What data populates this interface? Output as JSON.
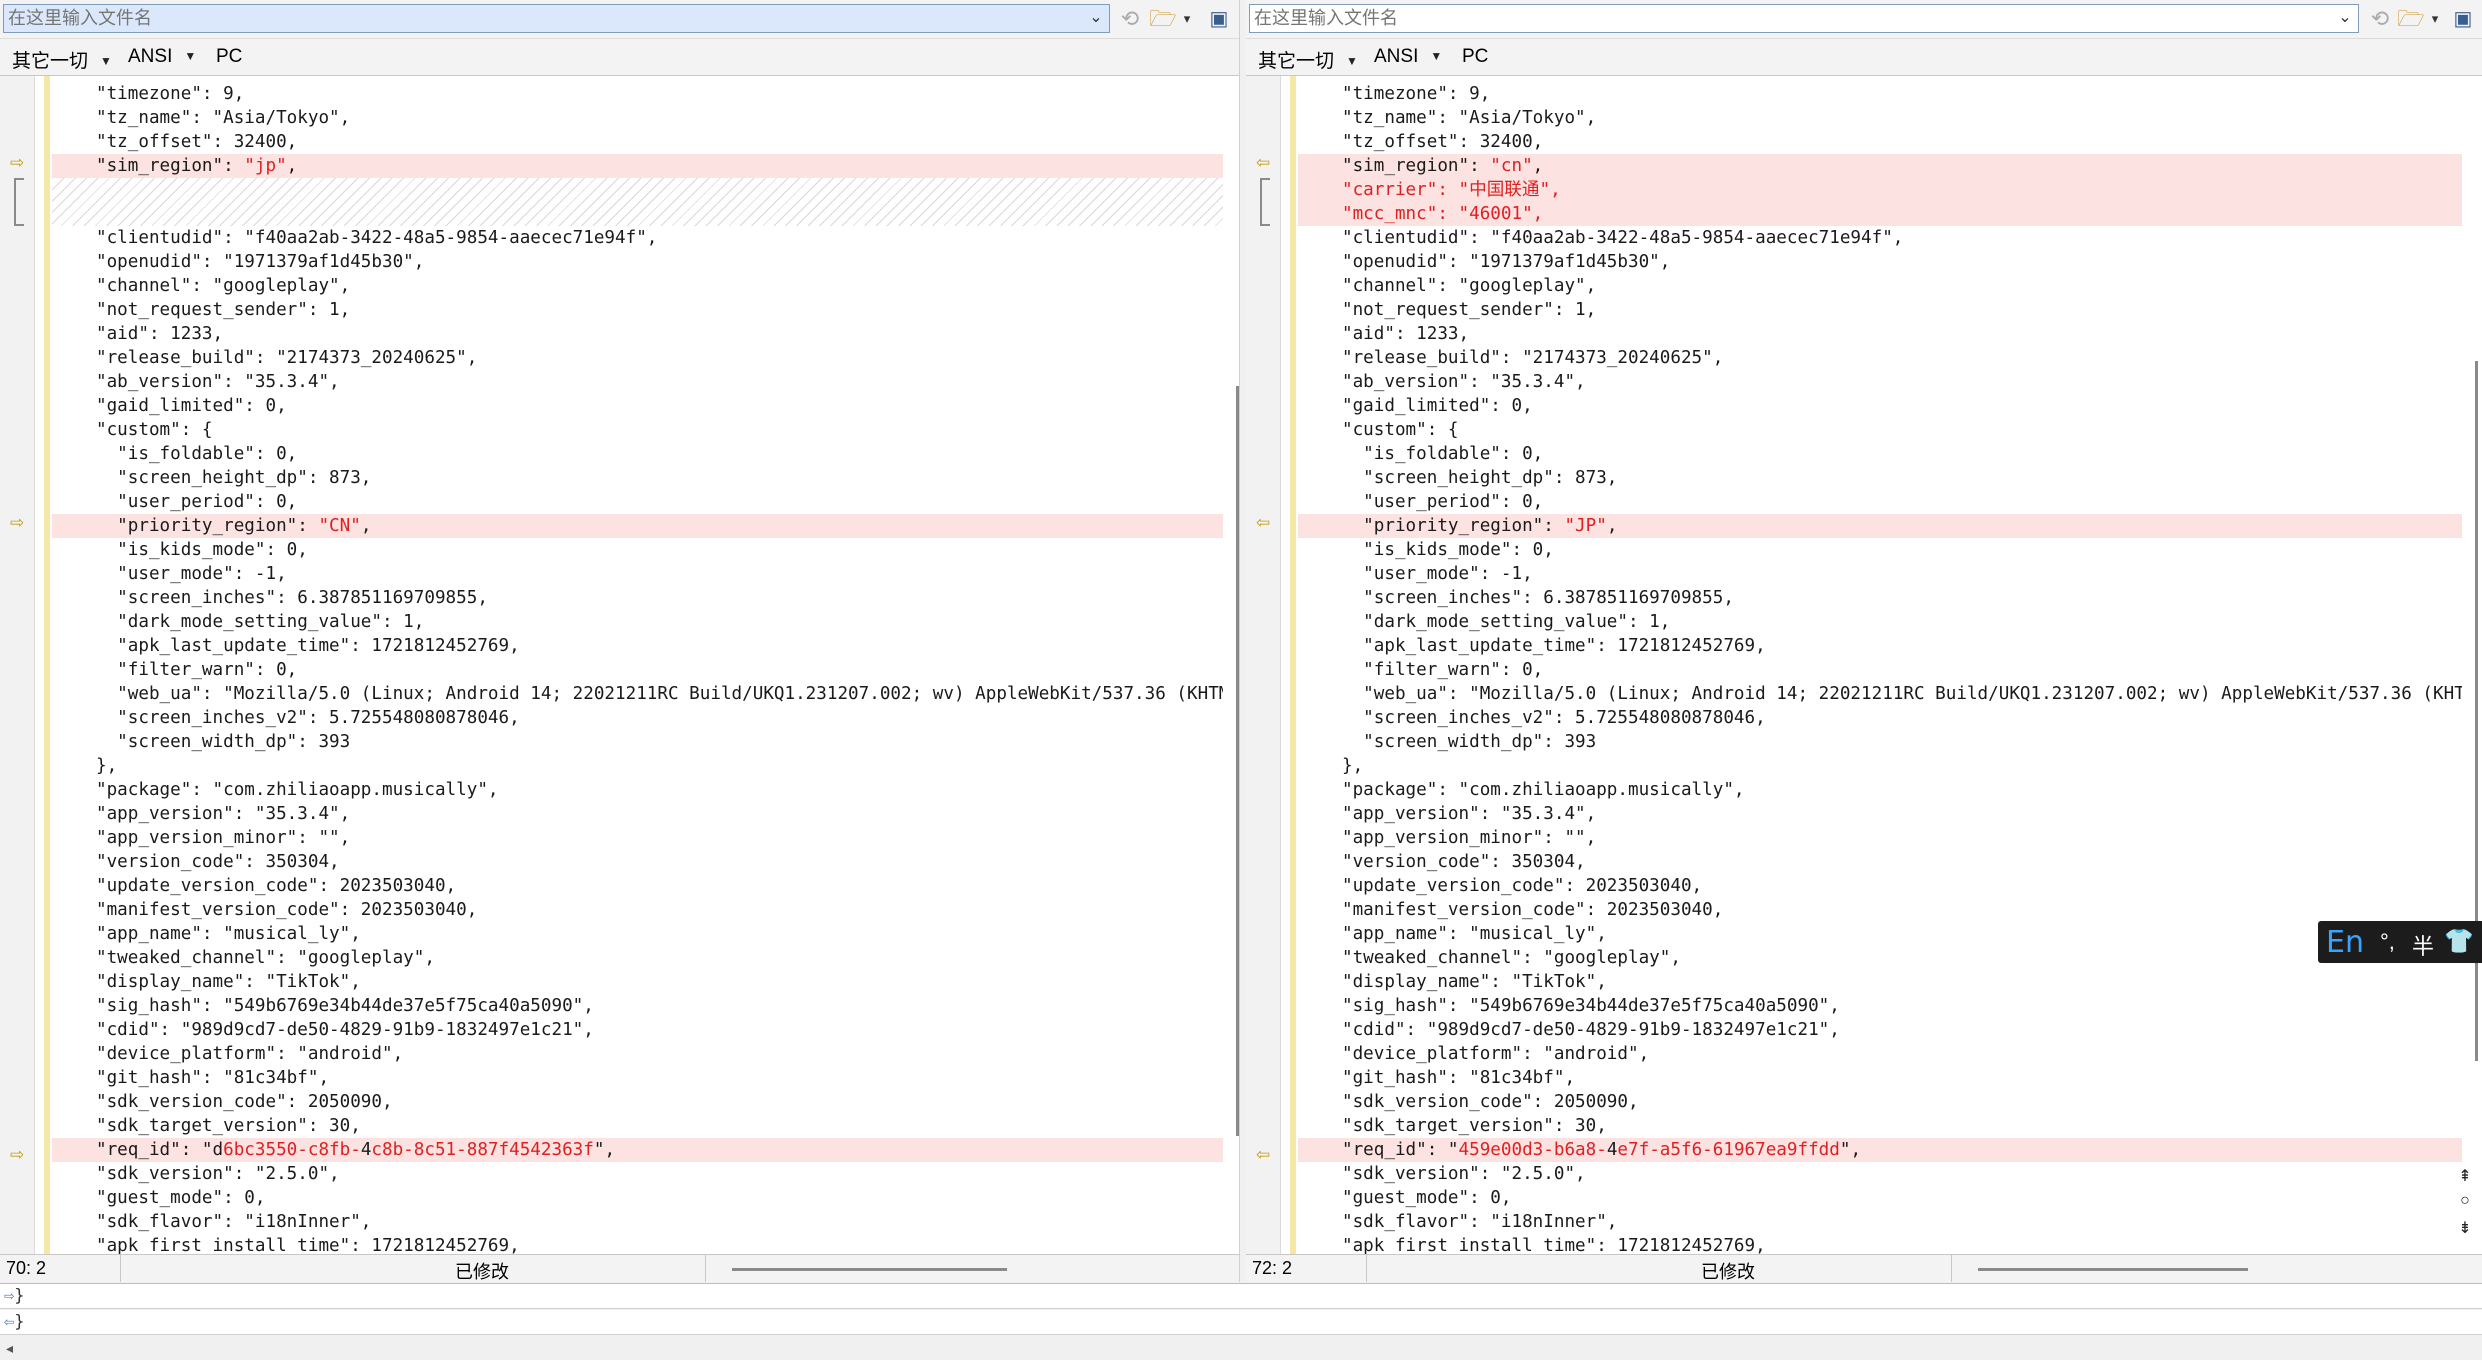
{
  "left": {
    "path_placeholder": "在这里输入文件名",
    "options": {
      "filter": "其它一切",
      "encoding": "ANSI",
      "line_ending": "PC"
    },
    "status": {
      "position": "70: 2",
      "modified": "已修改"
    },
    "lines": [
      {
        "text": "\"timezone\": 9,"
      },
      {
        "text": "\"tz_name\": \"Asia/Tokyo\","
      },
      {
        "text": "\"tz_offset\": 32400,"
      },
      {
        "text": "\"sim_region\": ",
        "hl": "\"jp\"",
        "tail": ",",
        "diff": true
      },
      {
        "placeholder": true
      },
      {
        "text": "\"clientudid\": \"f40aa2ab-3422-48a5-9854-aaecec71e94f\","
      },
      {
        "text": "\"openudid\": \"1971379af1d45b30\","
      },
      {
        "text": "\"channel\": \"googleplay\","
      },
      {
        "text": "\"not_request_sender\": 1,"
      },
      {
        "text": "\"aid\": 1233,"
      },
      {
        "text": "\"release_build\": \"2174373_20240625\","
      },
      {
        "text": "\"ab_version\": \"35.3.4\","
      },
      {
        "text": "\"gaid_limited\": 0,"
      },
      {
        "text": "\"custom\": {"
      },
      {
        "text": "  \"is_foldable\": 0,"
      },
      {
        "text": "  \"screen_height_dp\": 873,"
      },
      {
        "text": "  \"user_period\": 0,"
      },
      {
        "text": "  \"priority_region\": ",
        "hl": "\"CN\"",
        "tail": ",",
        "diff": true
      },
      {
        "text": "  \"is_kids_mode\": 0,"
      },
      {
        "text": "  \"user_mode\": -1,"
      },
      {
        "text": "  \"screen_inches\": 6.387851169709855,"
      },
      {
        "text": "  \"dark_mode_setting_value\": 1,"
      },
      {
        "text": "  \"apk_last_update_time\": 1721812452769,"
      },
      {
        "text": "  \"filter_warn\": 0,"
      },
      {
        "text": "  \"web_ua\": \"Mozilla/5.0 (Linux; Android 14; 22021211RC Build/UKQ1.231207.002; wv) AppleWebKit/537.36 (KHTM"
      },
      {
        "text": "  \"screen_inches_v2\": 5.725548080878046,"
      },
      {
        "text": "  \"screen_width_dp\": 393"
      },
      {
        "text": "},"
      },
      {
        "text": "\"package\": \"com.zhiliaoapp.musically\","
      },
      {
        "text": "\"app_version\": \"35.3.4\","
      },
      {
        "text": "\"app_version_minor\": \"\","
      },
      {
        "text": "\"version_code\": 350304,"
      },
      {
        "text": "\"update_version_code\": 2023503040,"
      },
      {
        "text": "\"manifest_version_code\": 2023503040,"
      },
      {
        "text": "\"app_name\": \"musical_ly\","
      },
      {
        "text": "\"tweaked_channel\": \"googleplay\","
      },
      {
        "text": "\"display_name\": \"TikTok\","
      },
      {
        "text": "\"sig_hash\": \"549b6769e34b44de37e5f75ca40a5090\","
      },
      {
        "text": "\"cdid\": \"989d9cd7-de50-4829-91b9-1832497e1c21\","
      },
      {
        "text": "\"device_platform\": \"android\","
      },
      {
        "text": "\"git_hash\": \"81c34bf\","
      },
      {
        "text": "\"sdk_version_code\": 2050090,"
      },
      {
        "text": "\"sdk_target_version\": 30,"
      },
      {
        "text": "\"req_id\": \"d",
        "hl": "6bc3550-c8fb-",
        "mid": "4",
        "hl2": "c8b-8c51-887f4542363f",
        "tail": "\",",
        "diff": true
      },
      {
        "text": "\"sdk_version\": \"2.5.0\","
      },
      {
        "text": "\"guest_mode\": 0,"
      },
      {
        "text": "\"sdk_flavor\": \"i18nInner\","
      },
      {
        "text": "\"apk_first_install_time\": 1721812452769,"
      }
    ]
  },
  "right": {
    "path_placeholder": "在这里输入文件名",
    "options": {
      "filter": "其它一切",
      "encoding": "ANSI",
      "line_ending": "PC"
    },
    "status": {
      "position": "72: 2",
      "modified": "已修改"
    },
    "lines": [
      {
        "text": "\"timezone\": 9,"
      },
      {
        "text": "\"tz_name\": \"Asia/Tokyo\","
      },
      {
        "text": "\"tz_offset\": 32400,"
      },
      {
        "text": "\"sim_region\": ",
        "hl": "\"cn\"",
        "tail": ",",
        "diff": true
      },
      {
        "text": "\"carrier\": \"中国联通\",",
        "added": true
      },
      {
        "text": "\"mcc_mnc\": \"46001\",",
        "added": true
      },
      {
        "text": "\"clientudid\": \"f40aa2ab-3422-48a5-9854-aaecec71e94f\","
      },
      {
        "text": "\"openudid\": \"1971379af1d45b30\","
      },
      {
        "text": "\"channel\": \"googleplay\","
      },
      {
        "text": "\"not_request_sender\": 1,"
      },
      {
        "text": "\"aid\": 1233,"
      },
      {
        "text": "\"release_build\": \"2174373_20240625\","
      },
      {
        "text": "\"ab_version\": \"35.3.4\","
      },
      {
        "text": "\"gaid_limited\": 0,"
      },
      {
        "text": "\"custom\": {"
      },
      {
        "text": "  \"is_foldable\": 0,"
      },
      {
        "text": "  \"screen_height_dp\": 873,"
      },
      {
        "text": "  \"user_period\": 0,"
      },
      {
        "text": "  \"priority_region\": ",
        "hl": "\"JP\"",
        "tail": ",",
        "diff": true
      },
      {
        "text": "  \"is_kids_mode\": 0,"
      },
      {
        "text": "  \"user_mode\": -1,"
      },
      {
        "text": "  \"screen_inches\": 6.387851169709855,"
      },
      {
        "text": "  \"dark_mode_setting_value\": 1,"
      },
      {
        "text": "  \"apk_last_update_time\": 1721812452769,"
      },
      {
        "text": "  \"filter_warn\": 0,"
      },
      {
        "text": "  \"web_ua\": \"Mozilla/5.0 (Linux; Android 14; 22021211RC Build/UKQ1.231207.002; wv) AppleWebKit/537.36 (KHT"
      },
      {
        "text": "  \"screen_inches_v2\": 5.725548080878046,"
      },
      {
        "text": "  \"screen_width_dp\": 393"
      },
      {
        "text": "},"
      },
      {
        "text": "\"package\": \"com.zhiliaoapp.musically\","
      },
      {
        "text": "\"app_version\": \"35.3.4\","
      },
      {
        "text": "\"app_version_minor\": \"\","
      },
      {
        "text": "\"version_code\": 350304,"
      },
      {
        "text": "\"update_version_code\": 2023503040,"
      },
      {
        "text": "\"manifest_version_code\": 2023503040,"
      },
      {
        "text": "\"app_name\": \"musical_ly\","
      },
      {
        "text": "\"tweaked_channel\": \"googleplay\","
      },
      {
        "text": "\"display_name\": \"TikTok\","
      },
      {
        "text": "\"sig_hash\": \"549b6769e34b44de37e5f75ca40a5090\","
      },
      {
        "text": "\"cdid\": \"989d9cd7-de50-4829-91b9-1832497e1c21\","
      },
      {
        "text": "\"device_platform\": \"android\","
      },
      {
        "text": "\"git_hash\": \"81c34bf\","
      },
      {
        "text": "\"sdk_version_code\": 2050090,"
      },
      {
        "text": "\"sdk_target_version\": 30,"
      },
      {
        "text": "\"req_id\": \"",
        "hl": "459e00d3-b6a8-",
        "mid": "4",
        "hl2": "e7f-a5f6-61967ea9ffdd",
        "tail": "\",",
        "diff": true
      },
      {
        "text": "\"sdk_version\": \"2.5.0\","
      },
      {
        "text": "\"guest_mode\": 0,"
      },
      {
        "text": "\"sdk_flavor\": \"i18nInner\","
      },
      {
        "text": "\"apk_first_install_time\": 1721812452769,"
      }
    ]
  },
  "bottom": {
    "line1": "}",
    "line2": "}"
  },
  "ime": {
    "lang": "En",
    "punct": "°,",
    "width": "半"
  },
  "colors": {
    "diff_bg": "#fde2e2",
    "diff_text": "#e02020",
    "marker": "#c89a10",
    "path_bg": "#dbe8fb"
  }
}
